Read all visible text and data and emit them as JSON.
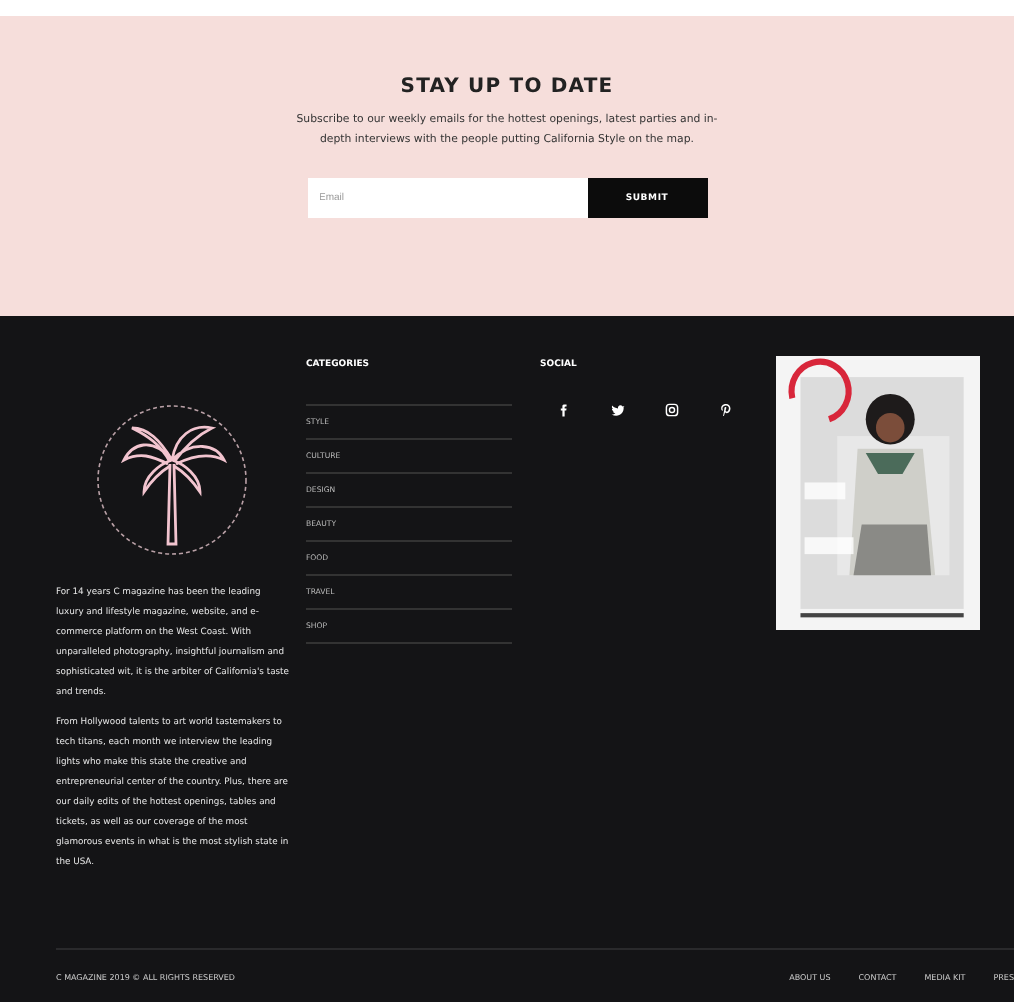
{
  "newsletter": {
    "title": "STAY UP TO DATE",
    "text": "Subscribe to our weekly emails for the hottest openings, latest parties and in-depth interviews with the people putting California Style on the map.",
    "email": {
      "placeholder": "Email"
    },
    "submit": "SUBMIT"
  },
  "about": {
    "paragraphs": [
      "For 14 years C magazine has been the leading luxury and lifestyle magazine, website, and e-commerce platform on the West Coast. With unparalleled photography, insightful journalism and sophisticated wit, it is the arbiter of California's taste and trends.",
      "From Hollywood talents to art world tastemakers to tech titans, each month we interview the leading lights who make this state the creative and entrepreneurial center of the country. Plus, there are our daily edits of the hottest openings, tables and tickets, as well as our coverage of the most glamorous events in what is the most stylish state in the USA."
    ]
  },
  "categories": {
    "title": "CATEGORIES",
    "items": [
      "STYLE",
      "CULTURE",
      "DESIGN",
      "BEAUTY",
      "FOOD",
      "TRAVEL",
      "SHOP"
    ]
  },
  "social": {
    "title": "SOCIAL",
    "icons": [
      {
        "kind": "facebook"
      },
      {
        "kind": "twitter"
      },
      {
        "kind": "instagram"
      },
      {
        "kind": "pinterest"
      }
    ]
  },
  "footer": {
    "copyright": "C MAGAZINE 2019 © ALL RIGHTS RESERVED",
    "links": [
      "ABOUT US",
      "CONTACT",
      "MEDIA KIT",
      "PRES"
    ]
  }
}
